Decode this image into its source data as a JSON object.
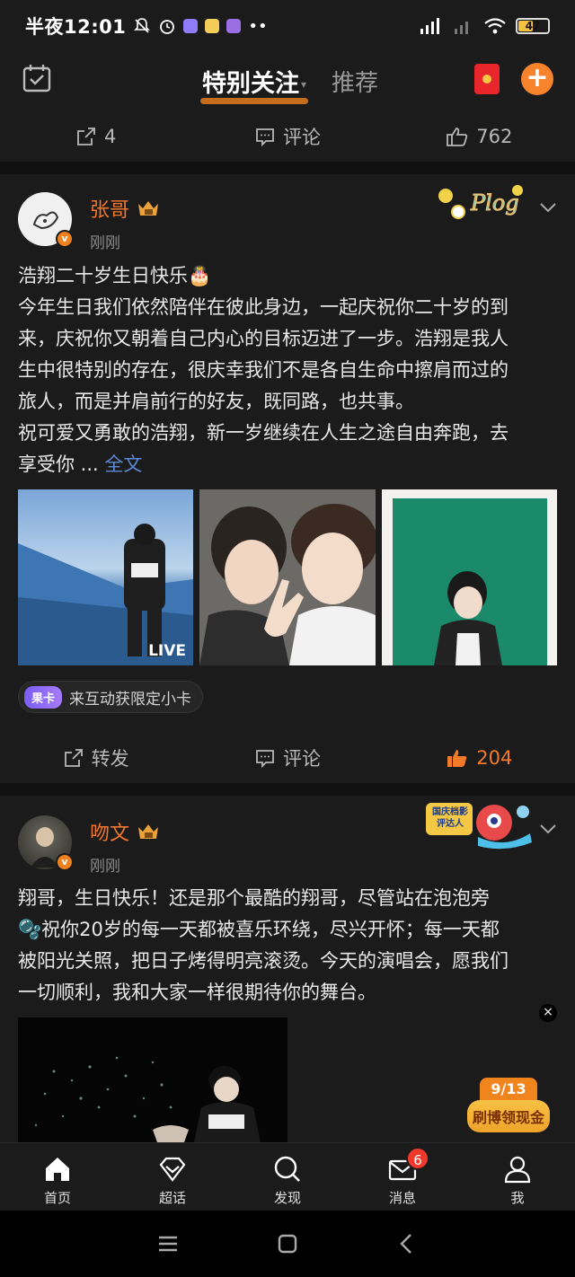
{
  "status_bar": {
    "time": "半夜12:01",
    "battery": "47"
  },
  "top_nav": {
    "tab_active": "特别关注",
    "tab_other": "推荐",
    "plus": "+"
  },
  "prev_post_actions": {
    "repost_count": "4",
    "comment_label": "评论",
    "like_count": "762"
  },
  "post1": {
    "username": "张哥",
    "time": "刚刚",
    "sticker_text": "Plog",
    "lines": [
      "浩翔二十岁生日快乐🎂",
      "今年生日我们依然陪伴在彼此身边，一起庆祝你二十岁的到",
      "来，庆祝你又朝着自己内心的目标迈进了一步。浩翔是我人",
      "生中很特别的存在，很庆幸我们不是各自生命中擦肩而过的",
      "旅人，而是并肩前行的好友，既同路，也共事。",
      "祝可爱又勇敢的浩翔，新一岁继续在人生之途自由奔跑，去"
    ],
    "last_line": "享受你 ... ",
    "more": "全文",
    "live_tag": "LIVE",
    "chip_tag": "果卡",
    "chip_text": "来互动获限定小卡",
    "actions": {
      "repost": "转发",
      "comment": "评论",
      "like_count": "204"
    }
  },
  "post2": {
    "username": "吻文",
    "time": "刚刚",
    "sticker_text": "国庆档影评达人",
    "lines": [
      "翔哥，生日快乐！还是那个最酷的翔哥，尽管站在泡泡旁",
      "🫧祝你20岁的每一天都被喜乐环绕，尽兴开怀；每一天都",
      "被阳光关照，把日子烤得明亮滚烫。今天的演唱会，愿我们",
      "一切顺利，我和大家一样很期待你的舞台。"
    ]
  },
  "cash_badge": {
    "progress": "9/13",
    "label": "刷博领现金"
  },
  "bottom_nav": {
    "items": [
      "首页",
      "超话",
      "发现",
      "消息",
      "我"
    ],
    "message_badge": "6"
  },
  "colors": {
    "accent": "#f2772b",
    "link": "#5b8bd6",
    "background": "#1b1b1b"
  }
}
